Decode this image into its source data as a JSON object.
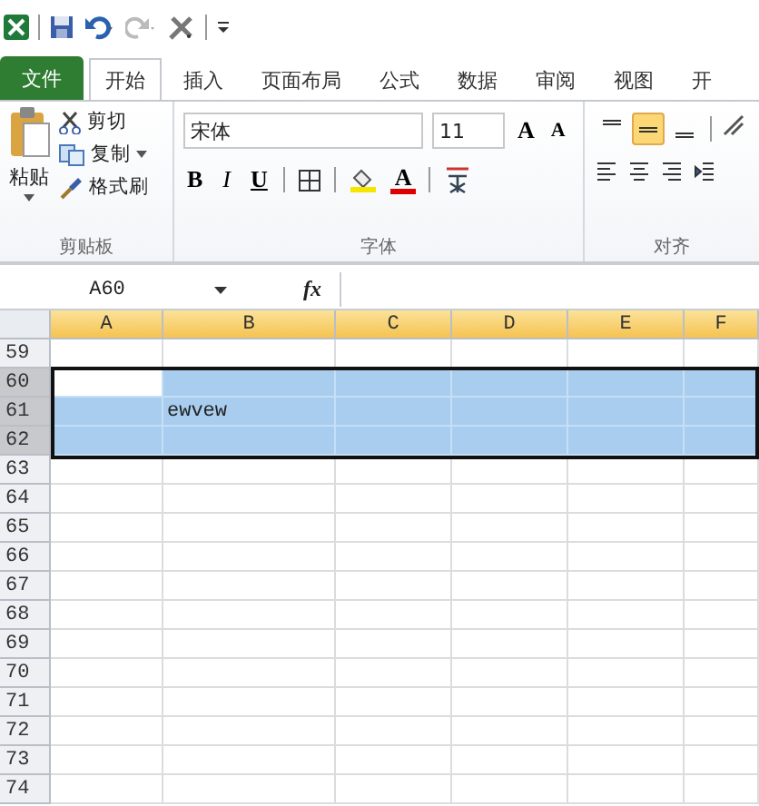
{
  "tabs": [
    {
      "label": "文件",
      "kind": "file",
      "selected": false
    },
    {
      "label": "开始",
      "kind": "tab",
      "selected": true
    },
    {
      "label": "插入",
      "kind": "tab",
      "selected": false
    },
    {
      "label": "页面布局",
      "kind": "tab",
      "selected": false
    },
    {
      "label": "公式",
      "kind": "tab",
      "selected": false
    },
    {
      "label": "数据",
      "kind": "tab",
      "selected": false
    },
    {
      "label": "审阅",
      "kind": "tab",
      "selected": false
    },
    {
      "label": "视图",
      "kind": "tab",
      "selected": false
    },
    {
      "label": "开",
      "kind": "tab",
      "selected": false
    }
  ],
  "clipboard": {
    "paste": "粘贴",
    "cut": "剪切",
    "copy": "复制",
    "painter": "格式刷",
    "group": "剪贴板"
  },
  "font": {
    "name": "宋体",
    "size": "11",
    "grow": "A",
    "shrink": "A",
    "bold": "B",
    "italic": "I",
    "underline": "U",
    "font_color_label": "A",
    "group": "字体"
  },
  "alignment": {
    "vertical": [
      {
        "selected": false
      },
      {
        "selected": true
      },
      {
        "selected": false
      }
    ],
    "group": "对齐"
  },
  "formula_bar": {
    "name_box": "A60",
    "fx": "fx"
  },
  "columns": [
    {
      "label": "A",
      "selected": true
    },
    {
      "label": "B",
      "selected": true
    },
    {
      "label": "C",
      "selected": true
    },
    {
      "label": "D",
      "selected": true
    },
    {
      "label": "E",
      "selected": true
    },
    {
      "label": "F",
      "selected": true
    }
  ],
  "rows": [
    {
      "number": "59",
      "selected": false
    },
    {
      "number": "60",
      "selected": true,
      "cells": [
        {
          "kind": "active"
        }
      ]
    },
    {
      "number": "61",
      "selected": true,
      "cells": [
        {
          "kind": "blank"
        },
        {
          "kind": "text",
          "text": "ewvew"
        }
      ]
    },
    {
      "number": "62",
      "selected": true
    },
    {
      "number": "63",
      "selected": false
    },
    {
      "number": "64",
      "selected": false
    },
    {
      "number": "65",
      "selected": false
    },
    {
      "number": "66",
      "selected": false
    },
    {
      "number": "67",
      "selected": false
    },
    {
      "number": "68",
      "selected": false
    },
    {
      "number": "69",
      "selected": false
    },
    {
      "number": "70",
      "selected": false
    },
    {
      "number": "71",
      "selected": false
    },
    {
      "number": "72",
      "selected": false
    },
    {
      "number": "73",
      "selected": false
    },
    {
      "number": "74",
      "selected": false
    }
  ]
}
